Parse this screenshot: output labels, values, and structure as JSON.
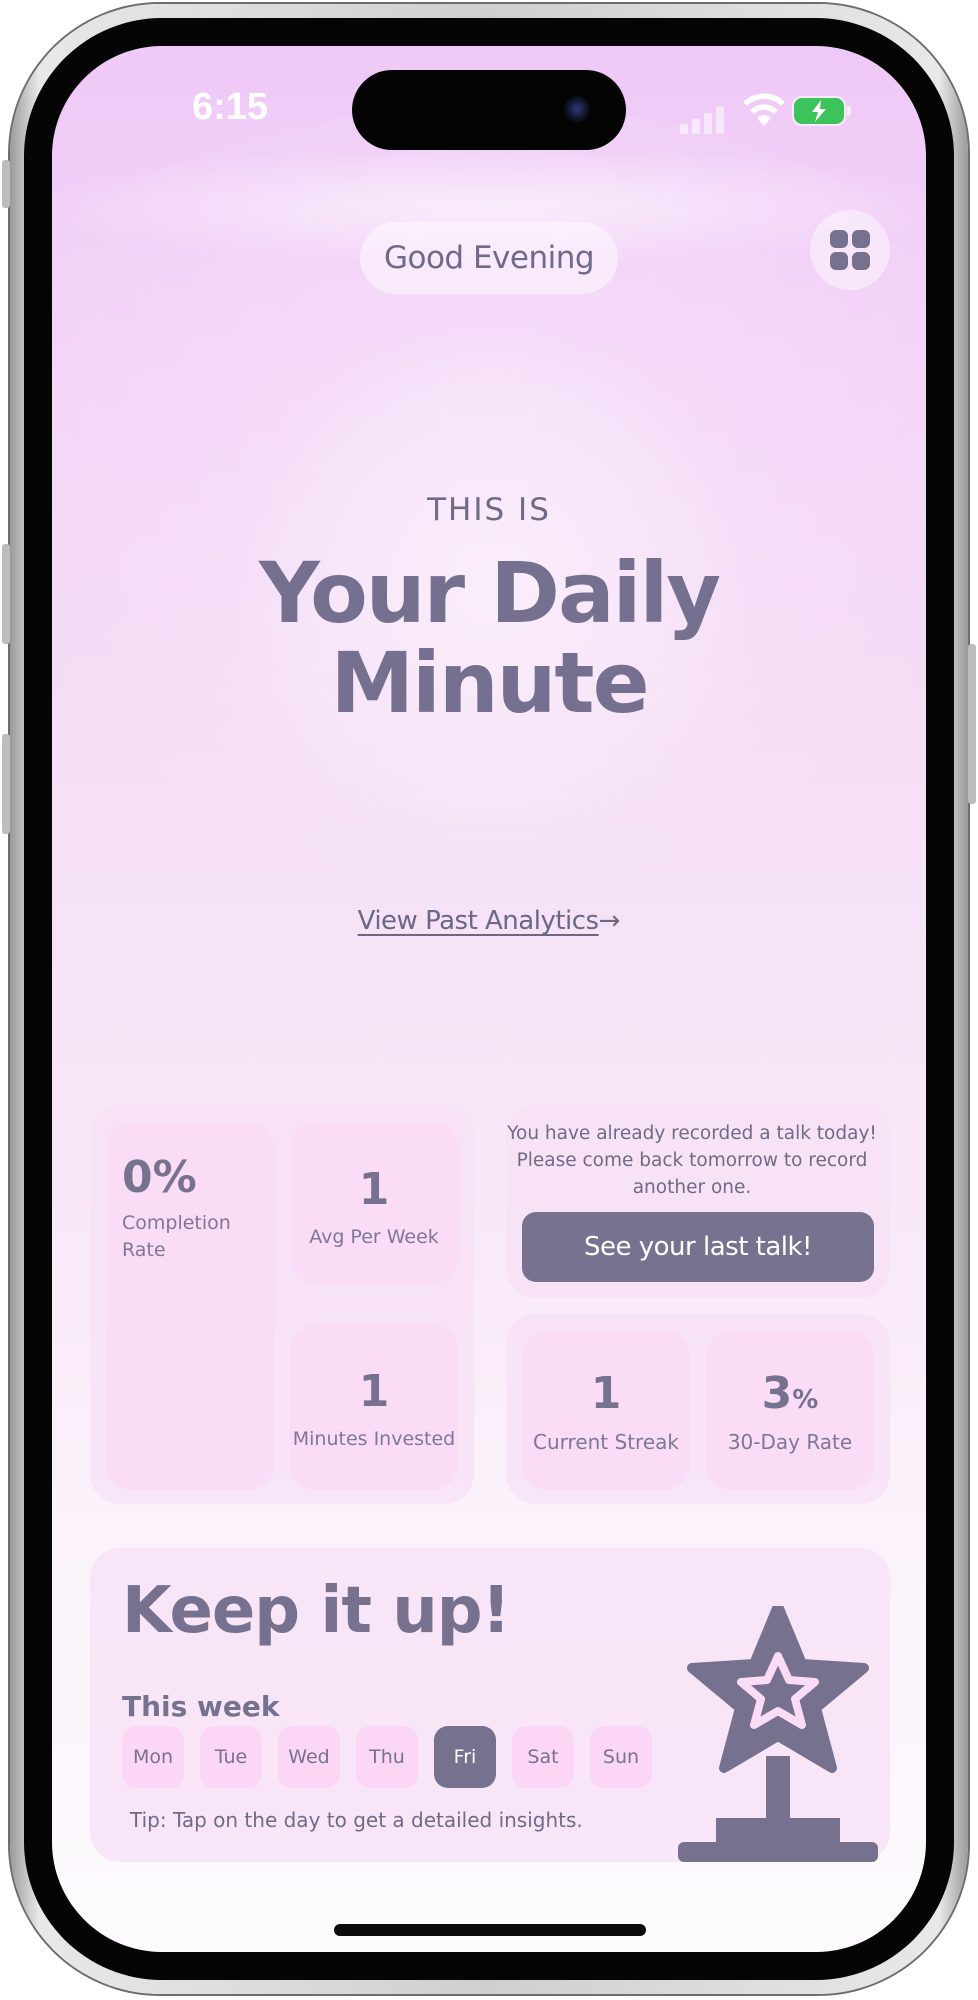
{
  "status_bar": {
    "time": "6:15"
  },
  "header": {
    "greeting": "Good Evening"
  },
  "hero": {
    "kicker": "THIS IS",
    "title_line1": "Your Daily",
    "title_line2": "Minute",
    "link_label": "View Past Analytics",
    "link_arrow": "→"
  },
  "stats": {
    "completion_value": "0%",
    "completion_label": "Completion Rate",
    "avg_value": "1",
    "avg_label": "Avg Per Week",
    "minutes_value": "1",
    "minutes_label": "Minutes Invested",
    "streak_value": "1",
    "streak_label": "Current Streak",
    "rate_value": "3",
    "rate_unit": "%",
    "rate_label": "30-Day Rate"
  },
  "talk": {
    "message": "You have already recorded a talk today! Please come back tomorrow to record another one.",
    "button": "See your last talk!"
  },
  "weekly": {
    "heading": "Keep it up!",
    "subheading": "This week",
    "days": [
      "Mon",
      "Tue",
      "Wed",
      "Thu",
      "Fri",
      "Sat",
      "Sun"
    ],
    "active_day": "Fri",
    "tip": "Tip: Tap on the day to get a detailed insights."
  },
  "colors": {
    "accent": "#76718f",
    "card": "#fbdcf6",
    "panel": "#f7e0f6",
    "battery": "#3cc35a"
  },
  "icons": [
    "menu-grid-icon",
    "arrow-right-icon",
    "trophy-star-icon",
    "signal-icon",
    "wifi-icon",
    "battery-charging-icon"
  ]
}
